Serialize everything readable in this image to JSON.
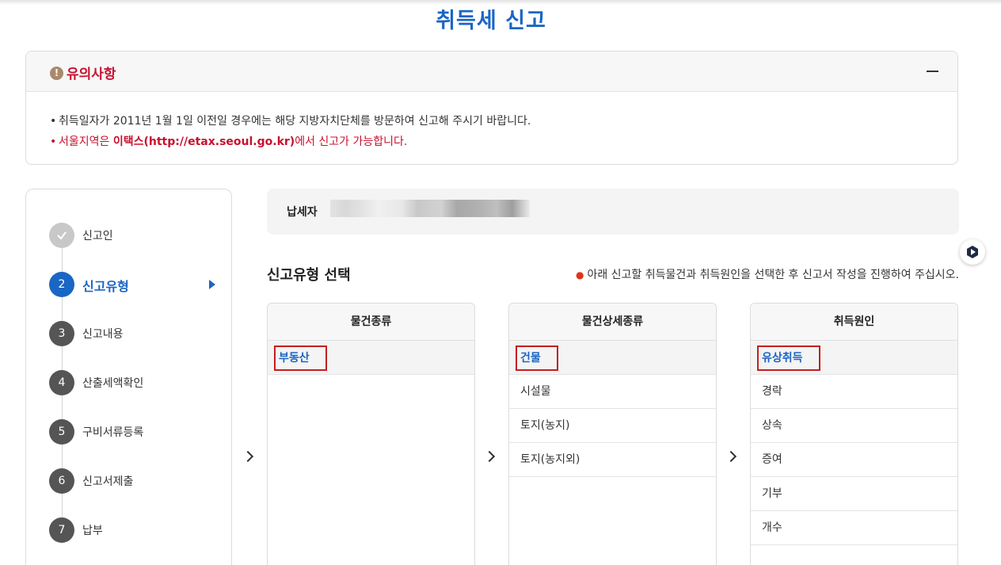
{
  "page": {
    "title": "취득세 신고"
  },
  "notice": {
    "title": "유의사항",
    "icon": "exclamation-icon",
    "line1": "취득일자가 2011년 1월 1일 이전일 경우에는 해당 지방자치단체를 방문하여 신고해 주시기 바랍니다.",
    "line2_prefix": "서울지역은 ",
    "line2_link": "이택스(http://etax.seoul.go.kr)",
    "line2_suffix": "에서 신고가 가능합니다."
  },
  "steps": [
    {
      "num": "",
      "label": "신고인",
      "state": "done"
    },
    {
      "num": "2",
      "label": "신고유형",
      "state": "active"
    },
    {
      "num": "3",
      "label": "신고내용",
      "state": "todo"
    },
    {
      "num": "4",
      "label": "산출세액확인",
      "state": "todo"
    },
    {
      "num": "5",
      "label": "구비서류등록",
      "state": "todo"
    },
    {
      "num": "6",
      "label": "신고서제출",
      "state": "todo"
    },
    {
      "num": "7",
      "label": "납부",
      "state": "todo"
    }
  ],
  "taxpayer": {
    "label": "납세자"
  },
  "section": {
    "title": "신고유형 선택",
    "note": "아래 신고할 취득물건과 취득원인을 선택한 후 신고서 작성을 진행하여 주십시오."
  },
  "columns": [
    {
      "header": "물건종류",
      "items": [
        "부동산"
      ],
      "selected": 0
    },
    {
      "header": "물건상세종류",
      "items": [
        "건물",
        "시설물",
        "토지(농지)",
        "토지(농지외)"
      ],
      "selected": 0
    },
    {
      "header": "취득원인",
      "items": [
        "유상취득",
        "경락",
        "상속",
        "증여",
        "기부",
        "개수"
      ],
      "selected": 0
    }
  ],
  "colors": {
    "accent": "#1a66c4",
    "alert": "#c8102e",
    "highlight_border": "#c21f1f"
  }
}
